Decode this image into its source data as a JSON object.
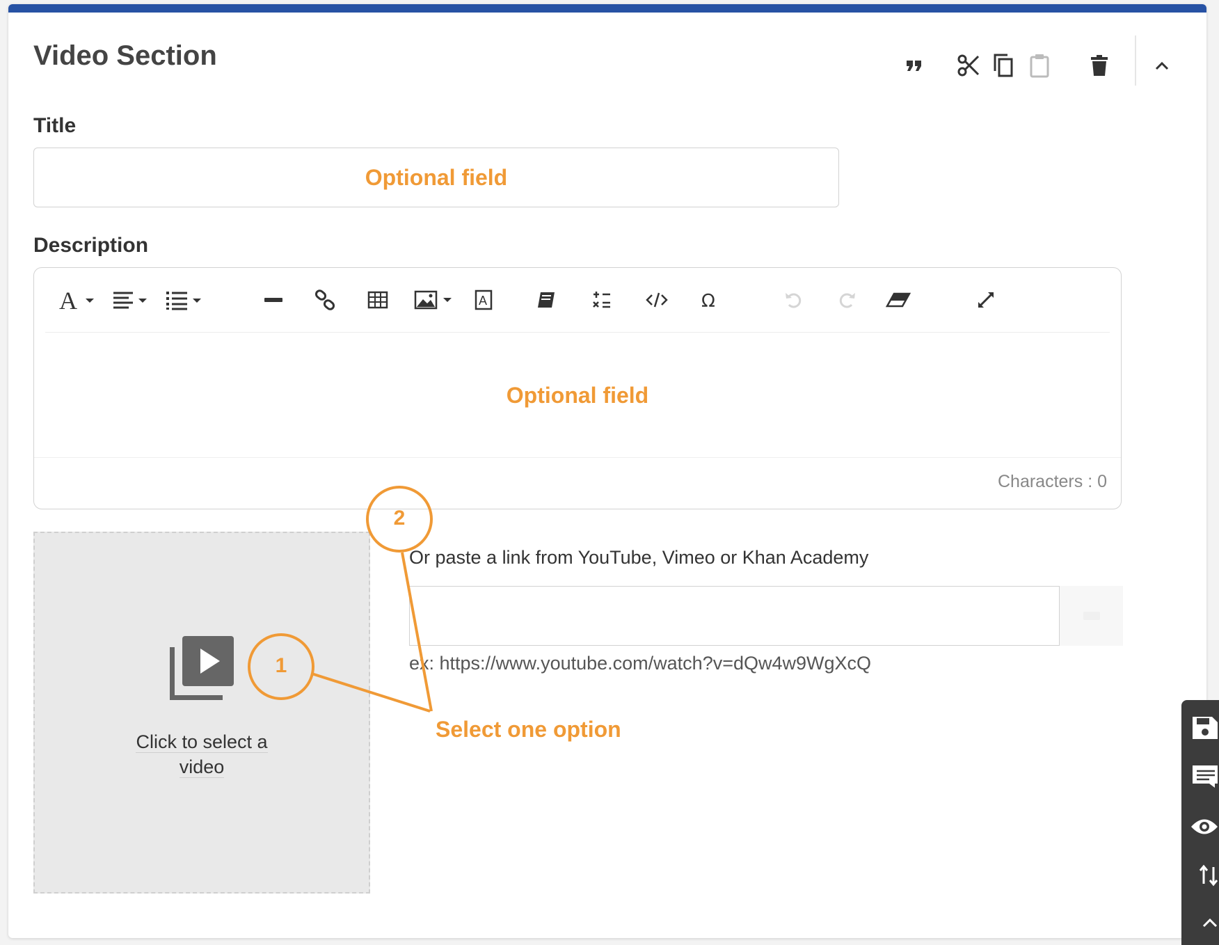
{
  "section": {
    "title": "Video Section"
  },
  "title_field": {
    "label": "Title",
    "placeholder": "Optional field"
  },
  "description_field": {
    "label": "Description",
    "placeholder": "Optional field",
    "char_count": "Characters : 0"
  },
  "video_picker": {
    "line1": "Click to select a",
    "line2": "video"
  },
  "link_field": {
    "label": "Or paste a link from YouTube, Vimeo or Khan Academy",
    "value": "",
    "example": "ex: https://www.youtube.com/watch?v=dQw4w9WgXcQ"
  },
  "annotations": {
    "marker1": "1",
    "marker2": "2",
    "hint": "Select one option"
  },
  "colors": {
    "accent_blue": "#2752a4",
    "annotation_orange": "#f09a36",
    "dock": "#3c3c3c"
  },
  "icons": {
    "top_actions": [
      "quote-icon",
      "scissors-icon",
      "copy-icon",
      "clipboard-icon",
      "trash-icon",
      "chevron-up-icon"
    ],
    "toolbar": [
      "font-icon",
      "align-left-icon",
      "list-icon",
      "horizontal-rule-icon",
      "link-icon",
      "table-icon",
      "image-icon",
      "text-box-icon",
      "book-icon",
      "math-icon",
      "code-icon",
      "omega-icon",
      "undo-icon",
      "redo-icon",
      "eraser-icon",
      "expand-icon"
    ],
    "dock": [
      "save-icon",
      "comment-icon",
      "eye-icon",
      "sort-icon",
      "chevron-up-icon"
    ]
  }
}
